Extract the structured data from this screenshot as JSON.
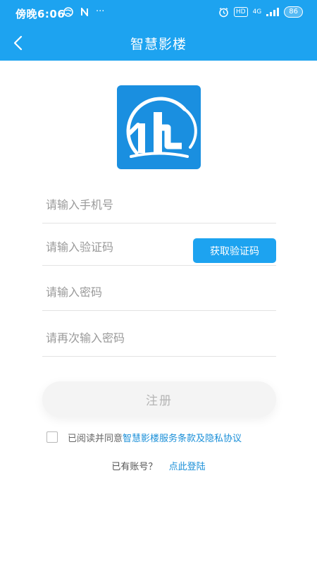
{
  "status_bar": {
    "time": "傍晚6:06",
    "network": "4G",
    "hd": "HD",
    "battery": "86"
  },
  "nav": {
    "title": "智慧影楼"
  },
  "form": {
    "phone_placeholder": "请输入手机号",
    "code_placeholder": "请输入验证码",
    "get_code_label": "获取验证码",
    "password_placeholder": "请输入密码",
    "confirm_password_placeholder": "请再次输入密码",
    "register_label": "注册"
  },
  "agreement": {
    "prefix": "已阅读并同意",
    "link_text": "智慧影楼服务条款及隐私协议"
  },
  "login": {
    "prompt": "已有账号？",
    "link_text": "点此登陆"
  },
  "colors": {
    "primary": "#1da3f0",
    "logo_bg": "#1a8fe0",
    "link": "#1a8fd8"
  }
}
